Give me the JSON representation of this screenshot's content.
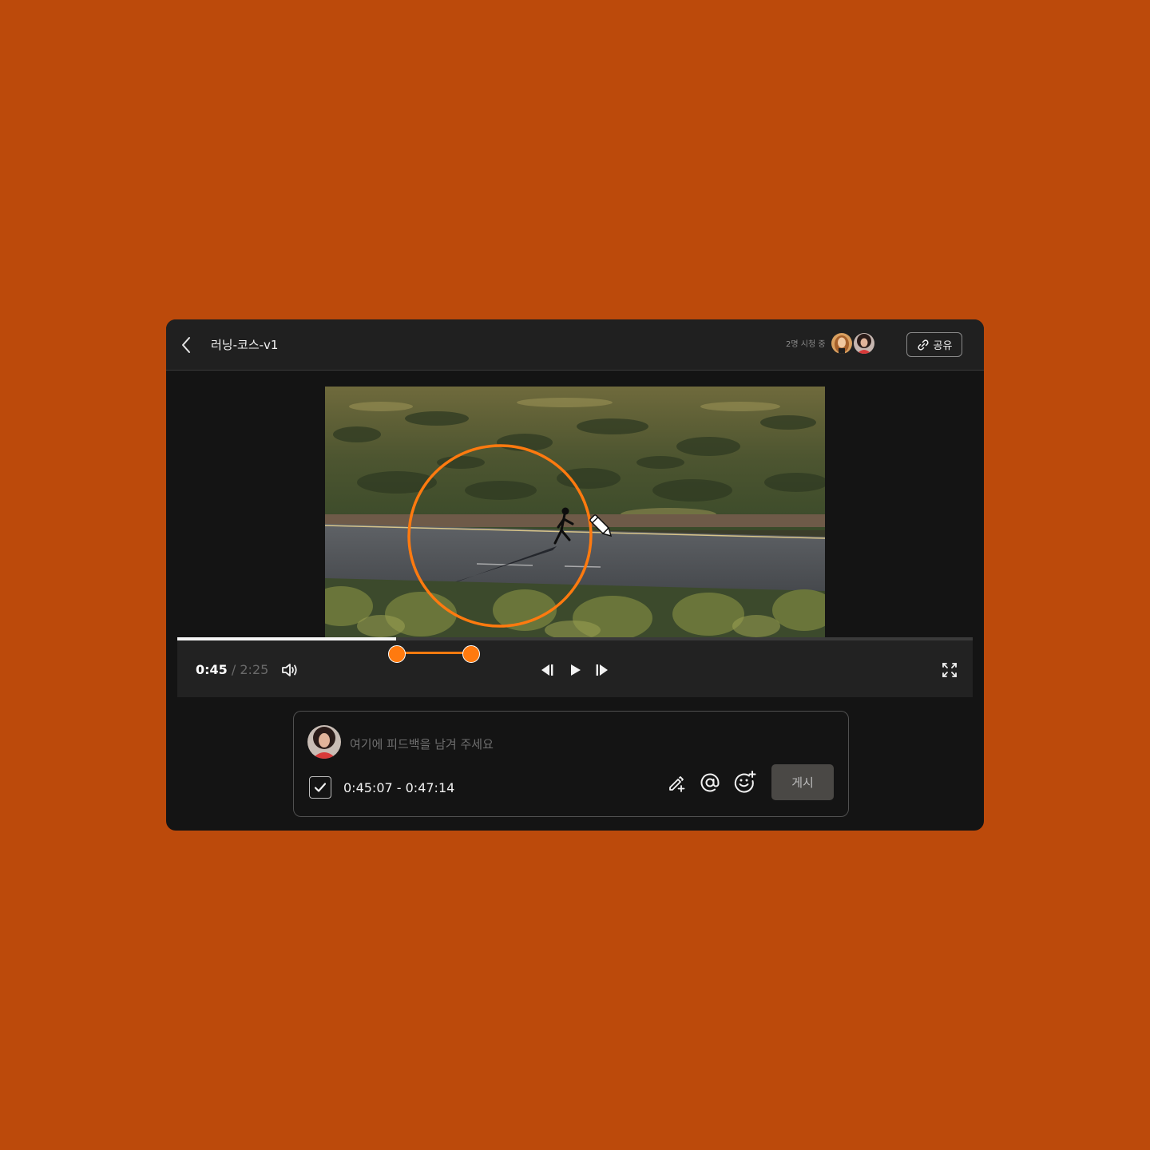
{
  "header": {
    "back_icon": "chevron-left-icon",
    "title": "러닝-코스-v1",
    "viewers_label": "2명 시청 중",
    "viewer_avatars": [
      "viewer-avatar-1",
      "viewer-avatar-2"
    ],
    "share_icon": "link-icon",
    "share_label": "공유"
  },
  "player": {
    "current_time": "0:45",
    "separator": "/",
    "duration": "2:25",
    "progress_fraction": 0.275,
    "range_start_fraction": 0.275,
    "range_end_fraction": 0.368,
    "accent_color": "#ff7a0f",
    "volume_icon": "volume-icon",
    "prev_frame_icon": "step-back-icon",
    "play_icon": "play-icon",
    "next_frame_icon": "step-forward-icon",
    "fullscreen_icon": "fullscreen-icon",
    "annotation_tool_icon": "pencil-icon"
  },
  "comment": {
    "placeholder": "여기에 피드백을 남겨 주세요",
    "value": "",
    "timestamp_checked": true,
    "time_range": "0:45:07 - 0:47:14",
    "draw_icon": "pencil-plus-icon",
    "mention_icon": "at-sign-icon",
    "emoji_icon": "emoji-add-icon",
    "post_label": "게시"
  },
  "colors": {
    "page_background": "#bc4a0b",
    "window_background": "#141414",
    "accent": "#ff7a0f"
  }
}
